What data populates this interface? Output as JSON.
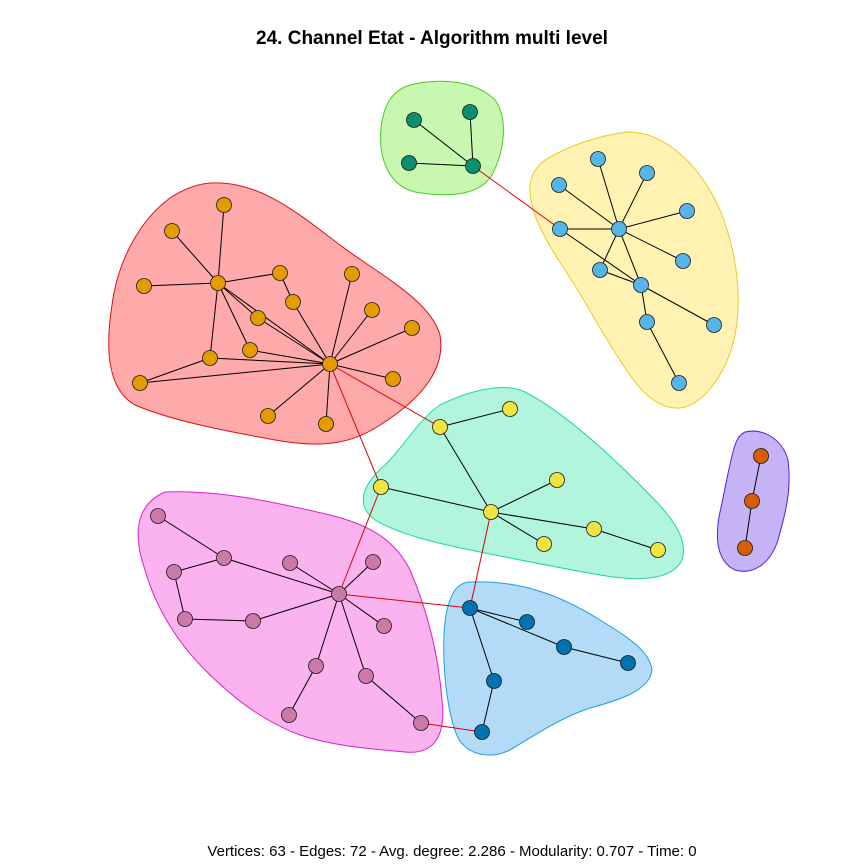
{
  "title": "24. Channel Etat - Algorithm multi level",
  "stats_line": "Vertices: 63 - Edges: 72 - Avg. degree: 2.286 - Modularity: 0.707 - Time: 0",
  "colors": {
    "edge_intra": "#000000",
    "edge_inter": "#e00000",
    "node_stroke": "#1a1a1a"
  },
  "communities": [
    {
      "id": "red",
      "fill": "#ffaaaa",
      "stroke": "#e01010",
      "node_color": "#e39b00"
    },
    {
      "id": "green",
      "fill": "#c8f7b0",
      "stroke": "#44cc22",
      "node_color": "#0b8f6f"
    },
    {
      "id": "yellow",
      "fill": "#fff2b3",
      "stroke": "#e8cc20",
      "node_color": "#56b4e9"
    },
    {
      "id": "mint",
      "fill": "#b0f5dc",
      "stroke": "#20d8a0",
      "node_color": "#f0e442"
    },
    {
      "id": "purple",
      "fill": "#c5b3f6",
      "stroke": "#5522dd",
      "node_color": "#d55e00"
    },
    {
      "id": "pink",
      "fill": "#fbb3f0",
      "stroke": "#d822c8",
      "node_color": "#cc79a7"
    },
    {
      "id": "blue",
      "fill": "#b3daf7",
      "stroke": "#1aa0e0",
      "node_color": "#0072b2"
    }
  ]
}
